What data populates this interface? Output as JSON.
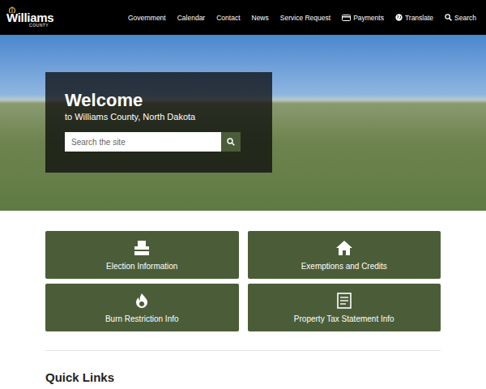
{
  "header": {
    "logo": {
      "title": "Williams",
      "subtitle": "COUNTY"
    },
    "nav": [
      {
        "label": "Government",
        "kind": "link"
      },
      {
        "label": "Calendar",
        "kind": "link"
      },
      {
        "label": "Contact",
        "kind": "link"
      },
      {
        "label": "News",
        "kind": "link"
      },
      {
        "label": "Service Request",
        "kind": "link"
      },
      {
        "label": "Payments",
        "kind": "icon-link"
      },
      {
        "label": "Translate",
        "kind": "icon-link"
      },
      {
        "label": "Search",
        "kind": "icon-link"
      }
    ]
  },
  "hero": {
    "title": "Welcome",
    "subtitle": "to Williams County, North Dakota",
    "search": {
      "placeholder": "Search the site"
    }
  },
  "tiles": [
    {
      "label": "Election Information"
    },
    {
      "label": "Exemptions and Credits"
    },
    {
      "label": "Burn Restriction Info"
    },
    {
      "label": "Property Tax Statement Info"
    }
  ],
  "quick_links": {
    "heading": "Quick Links"
  }
}
